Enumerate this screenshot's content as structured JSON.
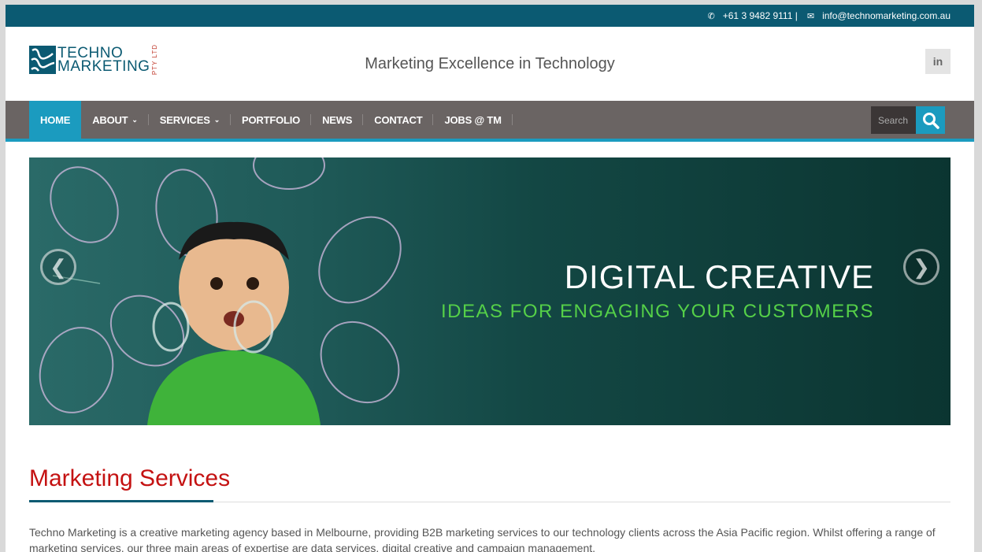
{
  "topbar": {
    "phone": "+61 3 9482 9111 |",
    "email": "info@technomarketing.com.au"
  },
  "header": {
    "logo_line1": "TECHNO",
    "logo_line2": "MARKETING",
    "logo_pty": "PTY LTD",
    "tagline": "Marketing Excellence in Technology",
    "linkedin_label": "in"
  },
  "nav": {
    "items": [
      {
        "label": "HOME",
        "dropdown": false
      },
      {
        "label": "ABOUT",
        "dropdown": true
      },
      {
        "label": "SERVICES",
        "dropdown": true
      },
      {
        "label": "PORTFOLIO",
        "dropdown": false
      },
      {
        "label": "NEWS",
        "dropdown": false
      },
      {
        "label": "CONTACT",
        "dropdown": false
      },
      {
        "label": "JOBS @ TM",
        "dropdown": false
      }
    ],
    "search_placeholder": "Search"
  },
  "slider": {
    "title": "DIGITAL CREATIVE",
    "subtitle": "IDEAS FOR ENGAGING YOUR CUSTOMERS",
    "prev_arrow": "❮",
    "next_arrow": "❯"
  },
  "main": {
    "section_title": "Marketing Services",
    "paragraph": "Techno Marketing is a creative marketing agency based in Melbourne, providing B2B marketing services to our technology clients across the Asia Pacific region. Whilst offering a range of marketing services, our three main areas of expertise are data services, digital creative and campaign management."
  },
  "colors": {
    "topbar": "#0b5a72",
    "nav": "#6a6463",
    "accent": "#1b9bbf",
    "section_title": "#c41212",
    "slide_subtitle": "#55d048"
  }
}
